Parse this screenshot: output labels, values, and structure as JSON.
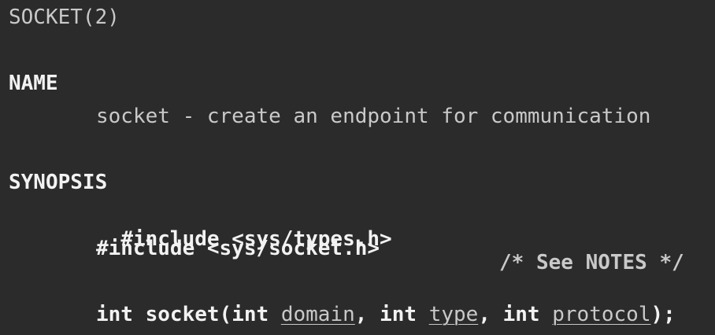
{
  "header": {
    "title": "SOCKET(2)"
  },
  "name_section": {
    "heading": "NAME",
    "description": "socket - create an endpoint for communication"
  },
  "synopsis": {
    "heading": "SYNOPSIS",
    "include1": "#include <sys/types.h>",
    "include1_comment": "/* See NOTES */",
    "include2": "#include <sys/socket.h>",
    "prototype": {
      "kw_int1": "int",
      "func": "socket(",
      "kw_int2": "int",
      "arg1": "domain",
      "sep1": ", ",
      "kw_int3": "int",
      "arg2": "type",
      "sep2": ", ",
      "kw_int4": "int",
      "arg3": "protocol",
      "end": ");"
    }
  }
}
